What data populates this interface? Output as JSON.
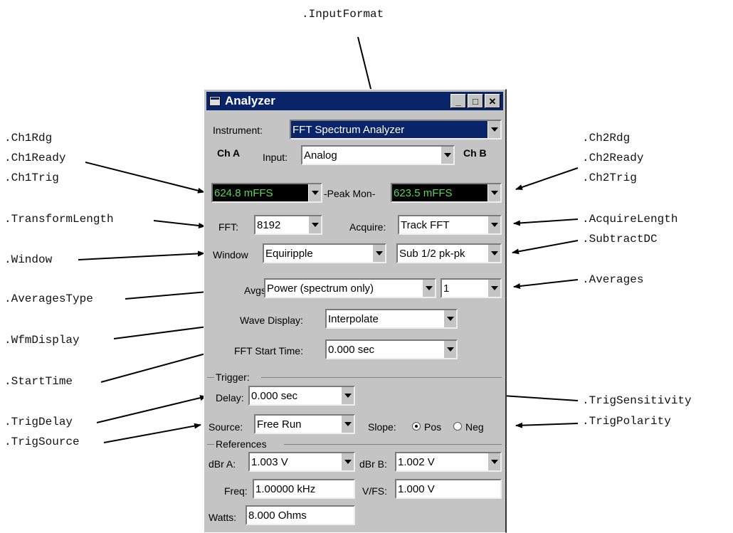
{
  "window": {
    "title": "Analyzer",
    "min": "_",
    "max": "□",
    "close": "✕"
  },
  "instrument": {
    "label": "Instrument:",
    "value": "FFT Spectrum Analyzer"
  },
  "channels": {
    "ch_a": "Ch A",
    "ch_b": "Ch B",
    "input_label": "Input:",
    "input_value": "Analog"
  },
  "readings": {
    "ch1_value": "624.8  mFFS",
    "peak_mon": "-Peak Mon-",
    "ch2_value": "623.5  mFFS"
  },
  "fft": {
    "label": "FFT:",
    "value": "8192",
    "acquire_label": "Acquire:",
    "acquire_value": "Track FFT"
  },
  "window_fn": {
    "label": "Window",
    "value": "Equiripple",
    "subtract_value": "Sub 1/2 pk-pk"
  },
  "avgs": {
    "label": "Avgs:",
    "type_value": "Power (spectrum only)",
    "count_value": "1"
  },
  "wave": {
    "label": "Wave Display:",
    "value": "Interpolate"
  },
  "fft_start": {
    "label": "FFT Start Time:",
    "value": "0.000   sec"
  },
  "trigger": {
    "group": "Trigger:",
    "delay_label": "Delay:",
    "delay_value": "0.000   sec",
    "source_label": "Source:",
    "source_value": "Free Run",
    "slope_label": "Slope:",
    "pos": "Pos",
    "neg": "Neg"
  },
  "references": {
    "group": "References",
    "dbra_label": "dBr A:",
    "dbra_value": "1.003   V",
    "dbrb_label": "dBr B:",
    "dbrb_value": "1.002   V",
    "freq_label": "Freq:",
    "freq_value": "1.00000 kHz",
    "vfs_label": "V/FS:",
    "vfs_value": "1.000   V",
    "watts_label": "Watts:",
    "watts_value": "8.000   Ohms"
  },
  "callouts": {
    "input_format": ".InputFormat",
    "ch1rdg": ".Ch1Rdg",
    "ch1ready": ".Ch1Ready",
    "ch1trig": ".Ch1Trig",
    "ch2rdg": ".Ch2Rdg",
    "ch2ready": ".Ch2Ready",
    "ch2trig": ".Ch2Trig",
    "transform_length": ".TransformLength",
    "acquire_length": ".AcquireLength",
    "window": ".Window",
    "subtract_dc": ".SubtractDC",
    "averages_type": ".AveragesType",
    "averages": ".Averages",
    "wfm_display": ".WfmDisplay",
    "start_time": ".StartTime",
    "trig_sensitivity": ".TrigSensitivity",
    "trig_delay": ".TrigDelay",
    "trig_polarity": ".TrigPolarity",
    "trig_source": ".TrigSource"
  }
}
